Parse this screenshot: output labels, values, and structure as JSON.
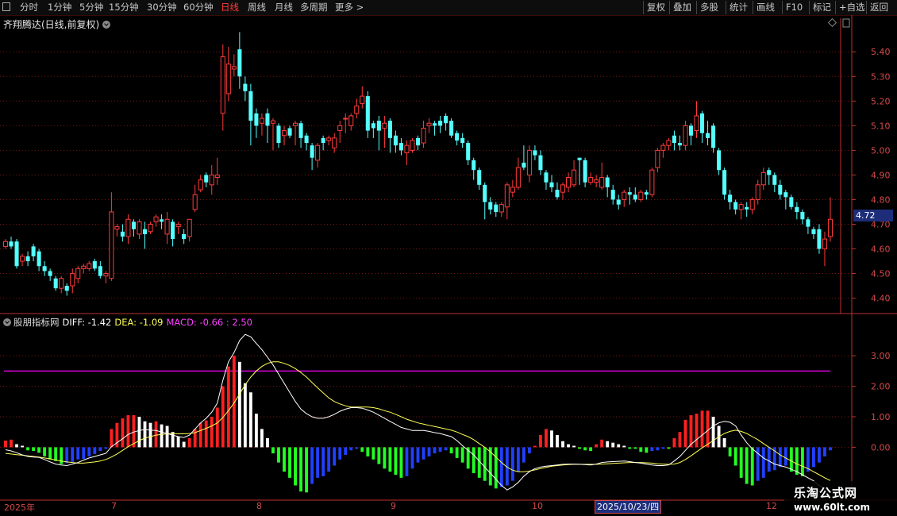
{
  "toolbar": {
    "left": [
      "分时",
      "1分钟",
      "5分钟",
      "15分钟",
      "30分钟",
      "60分钟",
      "日线",
      "周线",
      "月线",
      "多周期",
      "更多 >"
    ],
    "active": "日线",
    "right": [
      "复权",
      "叠加",
      "多股",
      "统计",
      "画线",
      "F10",
      "标记",
      "+自选",
      "返回"
    ]
  },
  "title": "齐翔腾达(日线,前复权)",
  "price_tag": "4.72",
  "macd_legend": {
    "indicator": "股朋指标网",
    "diff": "DIFF: -1.42",
    "dea": "DEA: -1.09",
    "macd": "MACD: -0.66 : 2.50"
  },
  "colors": {
    "up": "#ff3b3b",
    "down": "#54ffff",
    "grid": "#7a1515",
    "axis": "#c03030",
    "diff": "#ffffff",
    "dea": "#ffff55",
    "ref": "#ff00ff",
    "hist_red": "#ff2020",
    "hist_white": "#ffffff",
    "hist_green": "#22ff22",
    "hist_blue": "#2040ff"
  },
  "x_labels": [
    "2025年",
    "7",
    "8",
    "9",
    "10",
    "2025/10/23/四",
    "12"
  ],
  "watermark": {
    "title": "乐淘公式网",
    "url": "www.60lt.com"
  },
  "chart_data": {
    "type": "candlestick",
    "price_axis": {
      "ticks": [
        4.4,
        4.5,
        4.6,
        4.7,
        4.8,
        4.9,
        5.0,
        5.1,
        5.2,
        5.3,
        5.4
      ],
      "range": [
        4.36,
        5.52
      ]
    },
    "macd_axis": {
      "ticks": [
        0.0,
        1.0,
        2.0,
        3.0
      ],
      "range": [
        -1.55,
        4.2
      ],
      "ref_line": 2.5
    },
    "candles": [
      [
        4.61,
        4.63,
        4.6,
        4.64
      ],
      [
        4.63,
        4.61,
        4.6,
        4.65
      ],
      [
        4.63,
        4.53,
        4.52,
        4.64
      ],
      [
        4.55,
        4.57,
        4.53,
        4.58
      ],
      [
        4.57,
        4.55,
        4.53,
        4.59
      ],
      [
        4.61,
        4.57,
        4.55,
        4.62
      ],
      [
        4.59,
        4.53,
        4.51,
        4.6
      ],
      [
        4.53,
        4.51,
        4.49,
        4.55
      ],
      [
        4.51,
        4.49,
        4.47,
        4.52
      ],
      [
        4.48,
        4.44,
        4.43,
        4.49
      ],
      [
        4.44,
        4.48,
        4.42,
        4.49
      ],
      [
        4.45,
        4.43,
        4.41,
        4.46
      ],
      [
        4.45,
        4.5,
        4.42,
        4.52
      ],
      [
        4.48,
        4.52,
        4.46,
        4.53
      ],
      [
        4.52,
        4.53,
        4.5,
        4.54
      ],
      [
        4.52,
        4.54,
        4.51,
        4.55
      ],
      [
        4.55,
        4.52,
        4.51,
        4.56
      ],
      [
        4.53,
        4.49,
        4.48,
        4.55
      ],
      [
        4.49,
        4.5,
        4.46,
        4.51
      ],
      [
        4.48,
        4.75,
        4.47,
        4.83
      ],
      [
        4.68,
        4.69,
        4.65,
        4.7
      ],
      [
        4.67,
        4.65,
        4.63,
        4.7
      ],
      [
        4.65,
        4.72,
        4.62,
        4.74
      ],
      [
        4.71,
        4.68,
        4.65,
        4.72
      ],
      [
        4.66,
        4.71,
        4.64,
        4.72
      ],
      [
        4.68,
        4.66,
        4.6,
        4.71
      ],
      [
        4.67,
        4.7,
        4.66,
        4.71
      ],
      [
        4.71,
        4.73,
        4.69,
        4.74
      ],
      [
        4.72,
        4.71,
        4.68,
        4.74
      ],
      [
        4.66,
        4.72,
        4.62,
        4.75
      ],
      [
        4.71,
        4.64,
        4.61,
        4.72
      ],
      [
        4.69,
        4.7,
        4.66,
        4.71
      ],
      [
        4.66,
        4.64,
        4.62,
        4.68
      ],
      [
        4.65,
        4.72,
        4.63,
        4.72
      ],
      [
        4.76,
        4.82,
        4.75,
        4.86
      ],
      [
        4.84,
        4.88,
        4.83,
        4.9
      ],
      [
        4.9,
        4.87,
        4.85,
        4.91
      ],
      [
        4.86,
        4.9,
        4.82,
        4.94
      ],
      [
        4.89,
        4.9,
        4.86,
        4.97
      ],
      [
        5.15,
        5.38,
        5.08,
        5.43
      ],
      [
        5.23,
        5.35,
        5.2,
        5.42
      ],
      [
        5.33,
        5.34,
        5.3,
        5.39
      ],
      [
        5.41,
        5.3,
        5.25,
        5.48
      ],
      [
        5.27,
        5.24,
        5.2,
        5.3
      ],
      [
        5.24,
        5.12,
        5.02,
        5.27
      ],
      [
        5.15,
        5.1,
        5.05,
        5.17
      ],
      [
        5.11,
        5.13,
        5.06,
        5.15
      ],
      [
        5.15,
        5.1,
        5.03,
        5.17
      ],
      [
        5.11,
        5.12,
        5.0,
        5.13
      ],
      [
        5.1,
        5.03,
        5.01,
        5.11
      ],
      [
        5.06,
        5.08,
        5.02,
        5.1
      ],
      [
        5.09,
        5.06,
        5.05,
        5.1
      ],
      [
        5.1,
        5.11,
        5.02,
        5.12
      ],
      [
        5.11,
        5.05,
        5.01,
        5.12
      ],
      [
        5.06,
        5.03,
        5.0,
        5.07
      ],
      [
        5.02,
        4.97,
        4.92,
        5.03
      ],
      [
        4.96,
        5.02,
        4.93,
        5.03
      ],
      [
        5.05,
        5.03,
        5.0,
        5.06
      ],
      [
        5.04,
        5.05,
        5.02,
        5.06
      ],
      [
        5.01,
        5.05,
        4.99,
        5.07
      ],
      [
        5.08,
        5.1,
        5.03,
        5.12
      ],
      [
        5.13,
        5.13,
        5.07,
        5.15
      ],
      [
        5.1,
        5.14,
        5.08,
        5.15
      ],
      [
        5.15,
        5.18,
        5.13,
        5.21
      ],
      [
        5.19,
        5.22,
        5.17,
        5.26
      ],
      [
        5.22,
        5.08,
        5.05,
        5.24
      ],
      [
        5.11,
        5.09,
        5.05,
        5.12
      ],
      [
        5.12,
        5.08,
        5.0,
        5.14
      ],
      [
        5.09,
        5.11,
        5.01,
        5.14
      ],
      [
        5.12,
        5.05,
        4.99,
        5.13
      ],
      [
        5.06,
        5.02,
        4.99,
        5.08
      ],
      [
        5.03,
        5.0,
        4.98,
        5.05
      ],
      [
        4.99,
        5.02,
        4.94,
        5.04
      ],
      [
        5.0,
        5.04,
        4.99,
        5.05
      ],
      [
        5.05,
        5.02,
        5.0,
        5.06
      ],
      [
        5.03,
        5.09,
        5.01,
        5.12
      ],
      [
        5.1,
        5.11,
        5.07,
        5.13
      ],
      [
        5.11,
        5.1,
        5.06,
        5.12
      ],
      [
        5.12,
        5.1,
        5.07,
        5.14
      ],
      [
        5.14,
        5.11,
        5.08,
        5.15
      ],
      [
        5.12,
        5.06,
        5.05,
        5.13
      ],
      [
        5.07,
        5.04,
        5.02,
        5.08
      ],
      [
        5.05,
        5.03,
        5.01,
        5.07
      ],
      [
        5.03,
        4.96,
        4.94,
        5.04
      ],
      [
        4.96,
        4.92,
        4.88,
        4.97
      ],
      [
        4.92,
        4.86,
        4.84,
        4.93
      ],
      [
        4.86,
        4.79,
        4.72,
        4.87
      ],
      [
        4.79,
        4.76,
        4.74,
        4.81
      ],
      [
        4.78,
        4.75,
        4.73,
        4.79
      ],
      [
        4.75,
        4.78,
        4.73,
        4.79
      ],
      [
        4.77,
        4.86,
        4.72,
        4.87
      ],
      [
        4.83,
        4.85,
        4.81,
        4.88
      ],
      [
        4.85,
        4.93,
        4.84,
        4.97
      ],
      [
        4.95,
        4.93,
        4.92,
        5.02
      ],
      [
        4.9,
        5.0,
        4.87,
        5.02
      ],
      [
        5.0,
        4.98,
        4.96,
        5.02
      ],
      [
        4.98,
        4.92,
        4.9,
        5.0
      ],
      [
        4.91,
        4.87,
        4.84,
        4.92
      ],
      [
        4.87,
        4.85,
        4.83,
        4.9
      ],
      [
        4.84,
        4.81,
        4.8,
        4.87
      ],
      [
        4.83,
        4.86,
        4.8,
        4.87
      ],
      [
        4.85,
        4.89,
        4.83,
        4.91
      ],
      [
        4.86,
        4.92,
        4.85,
        4.96
      ],
      [
        4.97,
        4.96,
        4.86,
        4.97
      ],
      [
        4.96,
        4.87,
        4.85,
        4.97
      ],
      [
        4.87,
        4.89,
        4.86,
        4.91
      ],
      [
        4.87,
        4.88,
        4.85,
        4.9
      ],
      [
        4.85,
        4.89,
        4.84,
        4.95
      ],
      [
        4.89,
        4.85,
        4.81,
        4.9
      ],
      [
        4.84,
        4.8,
        4.78,
        4.86
      ],
      [
        4.8,
        4.78,
        4.76,
        4.82
      ],
      [
        4.8,
        4.83,
        4.77,
        4.84
      ],
      [
        4.83,
        4.82,
        4.78,
        4.85
      ],
      [
        4.82,
        4.8,
        4.79,
        4.85
      ],
      [
        4.8,
        4.83,
        4.79,
        4.84
      ],
      [
        4.83,
        4.82,
        4.8,
        4.84
      ],
      [
        4.82,
        4.92,
        4.81,
        4.93
      ],
      [
        4.93,
        5.0,
        4.91,
        5.01
      ],
      [
        5.0,
        5.02,
        4.97,
        5.03
      ],
      [
        5.02,
        5.04,
        5.0,
        5.05
      ],
      [
        5.06,
        5.03,
        5.0,
        5.08
      ],
      [
        5.03,
        5.02,
        5.0,
        5.06
      ],
      [
        5.02,
        5.1,
        5.0,
        5.12
      ],
      [
        5.1,
        5.06,
        5.02,
        5.11
      ],
      [
        5.08,
        5.14,
        5.05,
        5.2
      ],
      [
        5.15,
        5.07,
        5.03,
        5.16
      ],
      [
        5.07,
        5.05,
        5.02,
        5.12
      ],
      [
        5.1,
        5.01,
        4.99,
        5.11
      ],
      [
        5.0,
        4.92,
        4.9,
        5.01
      ],
      [
        4.92,
        4.82,
        4.8,
        4.93
      ],
      [
        4.82,
        4.79,
        4.76,
        4.84
      ],
      [
        4.79,
        4.76,
        4.74,
        4.8
      ],
      [
        4.76,
        4.78,
        4.72,
        4.79
      ],
      [
        4.77,
        4.76,
        4.73,
        4.79
      ],
      [
        4.76,
        4.8,
        4.74,
        4.81
      ],
      [
        4.8,
        4.86,
        4.78,
        4.88
      ],
      [
        4.86,
        4.91,
        4.84,
        4.93
      ],
      [
        4.92,
        4.9,
        4.86,
        4.93
      ],
      [
        4.9,
        4.86,
        4.83,
        4.91
      ],
      [
        4.86,
        4.82,
        4.8,
        4.88
      ],
      [
        4.83,
        4.81,
        4.76,
        4.84
      ],
      [
        4.81,
        4.77,
        4.76,
        4.82
      ],
      [
        4.77,
        4.75,
        4.72,
        4.79
      ],
      [
        4.75,
        4.72,
        4.7,
        4.76
      ],
      [
        4.72,
        4.69,
        4.66,
        4.73
      ],
      [
        4.68,
        4.66,
        4.64,
        4.69
      ],
      [
        4.68,
        4.6,
        4.58,
        4.7
      ],
      [
        4.6,
        4.64,
        4.53,
        4.67
      ],
      [
        4.65,
        4.72,
        4.63,
        4.81
      ]
    ],
    "hist": [
      0.22,
      0.25,
      0.1,
      0.05,
      -0.1,
      -0.12,
      -0.18,
      -0.3,
      -0.4,
      -0.45,
      -0.55,
      -0.52,
      -0.48,
      -0.4,
      -0.38,
      -0.3,
      -0.22,
      -0.12,
      -0.05,
      0.6,
      0.8,
      0.95,
      1.05,
      1.05,
      1.0,
      0.85,
      0.8,
      0.85,
      0.75,
      0.7,
      0.5,
      0.35,
      0.18,
      0.3,
      0.6,
      0.8,
      0.88,
      1.0,
      1.3,
      2.0,
      2.65,
      3.0,
      2.8,
      2.1,
      1.8,
      1.1,
      0.6,
      0.3,
      -0.2,
      -0.5,
      -0.8,
      -1.0,
      -1.25,
      -1.45,
      -1.48,
      -1.2,
      -1.0,
      -0.95,
      -0.8,
      -0.6,
      -0.4,
      -0.25,
      -0.1,
      -0.05,
      -0.15,
      -0.3,
      -0.4,
      -0.55,
      -0.7,
      -0.8,
      -0.9,
      -1.0,
      -0.95,
      -0.7,
      -0.5,
      -0.4,
      -0.3,
      -0.2,
      -0.15,
      -0.1,
      -0.2,
      -0.35,
      -0.5,
      -0.7,
      -0.85,
      -1.0,
      -1.1,
      -1.25,
      -1.35,
      -1.3,
      -1.25,
      -1.1,
      -0.8,
      -0.5,
      -0.2,
      0.05,
      0.4,
      0.6,
      0.55,
      0.4,
      0.2,
      0.1,
      0.05,
      -0.05,
      -0.1,
      -0.12,
      0.1,
      0.25,
      0.2,
      0.15,
      0.1,
      0.05,
      -0.05,
      -0.05,
      -0.15,
      -0.18,
      -0.12,
      -0.1,
      -0.05,
      -0.05,
      0.3,
      0.5,
      0.9,
      1.05,
      1.1,
      1.2,
      1.2,
      1.0,
      0.7,
      0.3,
      -0.3,
      -0.6,
      -1.0,
      -1.2,
      -1.25,
      -1.1,
      -1.0,
      -0.8,
      -0.75,
      -0.65,
      -0.6,
      -0.8,
      -0.9,
      -0.95,
      -0.8,
      -0.65,
      -0.5,
      -0.3,
      -0.1
    ],
    "diff": [
      -0.08,
      -0.12,
      -0.18,
      -0.25,
      -0.3,
      -0.32,
      -0.33,
      -0.4,
      -0.48,
      -0.55,
      -0.58,
      -0.6,
      -0.55,
      -0.5,
      -0.42,
      -0.35,
      -0.3,
      -0.25,
      -0.2,
      0.02,
      0.15,
      0.28,
      0.42,
      0.5,
      0.55,
      0.58,
      0.56,
      0.55,
      0.5,
      0.45,
      0.4,
      0.35,
      0.32,
      0.4,
      0.6,
      0.8,
      0.95,
      1.15,
      1.45,
      2.2,
      2.8,
      3.1,
      3.5,
      3.7,
      3.62,
      3.4,
      3.2,
      2.95,
      2.7,
      2.4,
      2.1,
      1.8,
      1.5,
      1.25,
      1.1,
      1.0,
      0.95,
      0.95,
      1.0,
      1.08,
      1.18,
      1.25,
      1.3,
      1.3,
      1.28,
      1.22,
      1.15,
      1.05,
      0.95,
      0.85,
      0.75,
      0.65,
      0.6,
      0.55,
      0.55,
      0.55,
      0.52,
      0.48,
      0.45,
      0.4,
      0.35,
      0.22,
      0.05,
      -0.1,
      -0.25,
      -0.45,
      -0.65,
      -0.85,
      -1.05,
      -1.25,
      -1.4,
      -1.3,
      -1.15,
      -0.95,
      -0.8,
      -0.7,
      -0.65,
      -0.62,
      -0.6,
      -0.58,
      -0.56,
      -0.55,
      -0.55,
      -0.56,
      -0.57,
      -0.58,
      -0.55,
      -0.5,
      -0.48,
      -0.47,
      -0.46,
      -0.45,
      -0.47,
      -0.5,
      -0.52,
      -0.55,
      -0.58,
      -0.6,
      -0.6,
      -0.58,
      -0.45,
      -0.3,
      -0.1,
      0.1,
      0.25,
      0.4,
      0.55,
      0.7,
      0.8,
      0.85,
      0.82,
      0.7,
      0.4,
      0.15,
      -0.05,
      -0.2,
      -0.35,
      -0.45,
      -0.55,
      -0.6,
      -0.65,
      -0.72,
      -0.8,
      -0.9,
      -1.0,
      -1.1,
      -1.25,
      -1.35,
      -1.42
    ],
    "dea": [
      -0.2,
      -0.22,
      -0.24,
      -0.26,
      -0.28,
      -0.3,
      -0.32,
      -0.35,
      -0.38,
      -0.42,
      -0.45,
      -0.48,
      -0.5,
      -0.52,
      -0.52,
      -0.5,
      -0.48,
      -0.45,
      -0.4,
      -0.32,
      -0.22,
      -0.1,
      0.02,
      0.12,
      0.22,
      0.3,
      0.35,
      0.4,
      0.42,
      0.44,
      0.45,
      0.44,
      0.44,
      0.45,
      0.48,
      0.55,
      0.62,
      0.7,
      0.8,
      0.98,
      1.2,
      1.45,
      1.75,
      2.05,
      2.3,
      2.5,
      2.65,
      2.75,
      2.8,
      2.8,
      2.75,
      2.68,
      2.58,
      2.45,
      2.3,
      2.12,
      1.95,
      1.78,
      1.62,
      1.5,
      1.42,
      1.36,
      1.32,
      1.32,
      1.32,
      1.32,
      1.3,
      1.26,
      1.2,
      1.15,
      1.08,
      1.0,
      0.92,
      0.86,
      0.8,
      0.76,
      0.72,
      0.68,
      0.64,
      0.6,
      0.56,
      0.5,
      0.42,
      0.35,
      0.25,
      0.12,
      0.0,
      -0.15,
      -0.32,
      -0.5,
      -0.65,
      -0.75,
      -0.8,
      -0.8,
      -0.78,
      -0.74,
      -0.7,
      -0.66,
      -0.62,
      -0.6,
      -0.58,
      -0.57,
      -0.56,
      -0.56,
      -0.56,
      -0.56,
      -0.56,
      -0.55,
      -0.54,
      -0.53,
      -0.52,
      -0.51,
      -0.5,
      -0.5,
      -0.5,
      -0.51,
      -0.52,
      -0.54,
      -0.55,
      -0.56,
      -0.55,
      -0.5,
      -0.4,
      -0.28,
      -0.15,
      -0.02,
      0.1,
      0.22,
      0.35,
      0.45,
      0.52,
      0.56,
      0.52,
      0.45,
      0.35,
      0.25,
      0.12,
      0.0,
      -0.12,
      -0.25,
      -0.35,
      -0.45,
      -0.55,
      -0.62,
      -0.7,
      -0.8,
      -0.9,
      -1.0,
      -1.09
    ]
  }
}
